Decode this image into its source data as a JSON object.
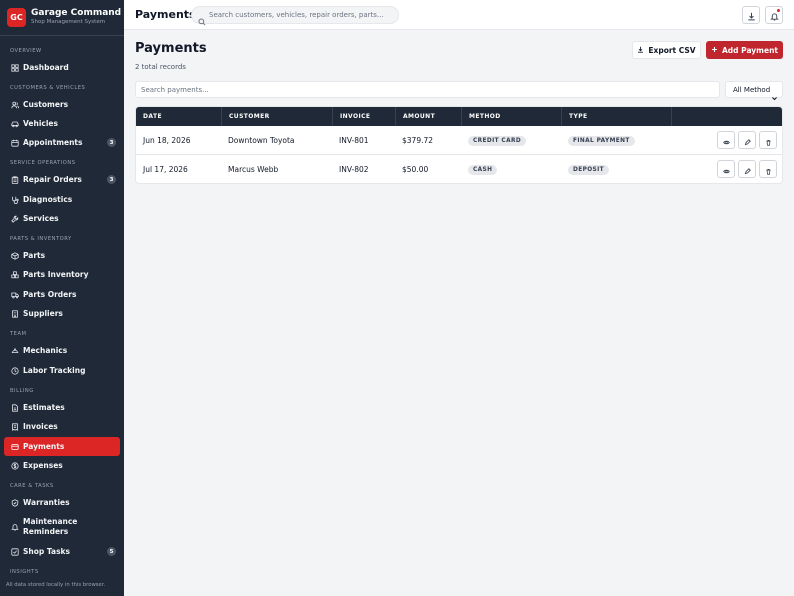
{
  "brand": {
    "initials": "GC",
    "name": "Garage Command",
    "subtitle": "Shop Management System"
  },
  "sidebar": {
    "sections": {
      "overview": "OVERVIEW",
      "customers_vehicles": "CUSTOMERS & VEHICLES",
      "service_operations": "SERVICE OPERATIONS",
      "parts_inventory": "PARTS & INVENTORY",
      "team": "TEAM",
      "billing": "BILLING",
      "care_tasks": "CARE & TASKS",
      "insights": "INSIGHTS"
    },
    "items": [
      {
        "label": "Dashboard",
        "icon": "dashboard-icon"
      },
      {
        "label": "Customers",
        "icon": "users-icon"
      },
      {
        "label": "Vehicles",
        "icon": "car-icon"
      },
      {
        "label": "Appointments",
        "icon": "calendar-icon",
        "badge": "3"
      },
      {
        "label": "Repair Orders",
        "icon": "clipboard-icon",
        "badge": "3"
      },
      {
        "label": "Diagnostics",
        "icon": "stethoscope-icon"
      },
      {
        "label": "Services",
        "icon": "wrench-icon"
      },
      {
        "label": "Parts",
        "icon": "package-icon"
      },
      {
        "label": "Parts Inventory",
        "icon": "boxes-icon"
      },
      {
        "label": "Parts Orders",
        "icon": "truck-icon"
      },
      {
        "label": "Suppliers",
        "icon": "building-icon"
      },
      {
        "label": "Mechanics",
        "icon": "hardhat-icon"
      },
      {
        "label": "Labor Tracking",
        "icon": "clock-icon"
      },
      {
        "label": "Estimates",
        "icon": "file-icon"
      },
      {
        "label": "Invoices",
        "icon": "receipt-icon"
      },
      {
        "label": "Payments",
        "icon": "credit-card-icon",
        "active": true
      },
      {
        "label": "Expenses",
        "icon": "dollar-icon"
      },
      {
        "label": "Warranties",
        "icon": "shield-icon"
      },
      {
        "label": "Maintenance",
        "label2": "Reminders",
        "icon": "bell-icon"
      },
      {
        "label": "Shop Tasks",
        "icon": "checkbox-icon",
        "badge": "5"
      }
    ],
    "footer_note": "All data stored locally in this browser."
  },
  "topbar": {
    "title": "Payments",
    "search_placeholder": "Search customers, vehicles, repair orders, parts..."
  },
  "main": {
    "title": "Payments",
    "subtitle": "2 total records",
    "export_label": "Export CSV",
    "add_label": "Add Payment",
    "filter_placeholder": "Search payments...",
    "method_filter": "All Method"
  },
  "table": {
    "columns": [
      "DATE",
      "CUSTOMER",
      "INVOICE",
      "AMOUNT",
      "METHOD",
      "TYPE"
    ],
    "rows": [
      {
        "date": "Jun 18, 2026",
        "customer": "Downtown Toyota",
        "invoice": "INV-801",
        "amount": "$379.72",
        "method": "CREDIT CARD",
        "type": "FINAL PAYMENT"
      },
      {
        "date": "Jul 17, 2026",
        "customer": "Marcus Webb",
        "invoice": "INV-802",
        "amount": "$50.00",
        "method": "CASH",
        "type": "DEPOSIT"
      }
    ]
  },
  "colors": {
    "accent": "#dc2626",
    "sidebar_bg": "#1f2937",
    "header_bg": "#1f2937"
  }
}
